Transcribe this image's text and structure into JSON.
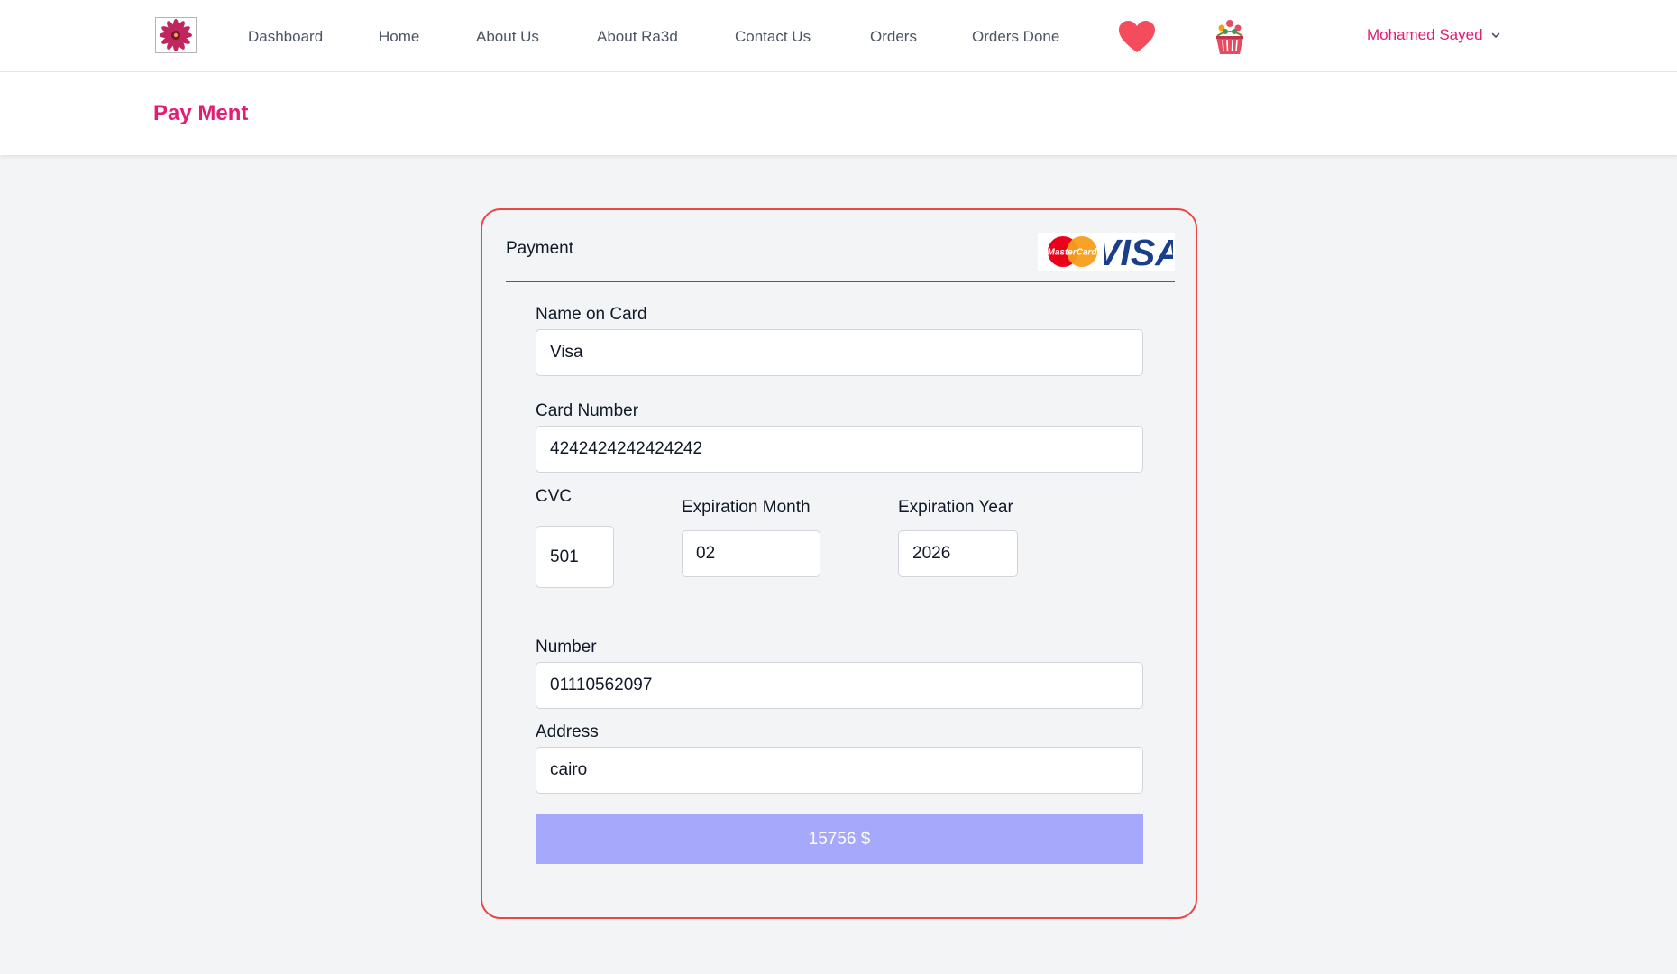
{
  "navbar": {
    "logo_icon": "flower-logo-icon",
    "links": [
      {
        "label": "Dashboard"
      },
      {
        "label": "Home"
      },
      {
        "label": "About Us"
      },
      {
        "label": "About Ra3d"
      },
      {
        "label": "Contact Us"
      },
      {
        "label": "Orders"
      },
      {
        "label": "Orders Done"
      }
    ],
    "wishlist_icon": "heart-icon",
    "cart_icon": "flower-basket-icon",
    "user_name": "Mohamed Sayed",
    "user_menu_icon": "chevron-down-icon"
  },
  "page": {
    "title": "Pay Ment"
  },
  "payment": {
    "title": "Payment",
    "mastercard_text": "MasterCard",
    "visa_text": "VISA",
    "fields": {
      "name_on_card": {
        "label": "Name on Card",
        "value": "Visa"
      },
      "card_number": {
        "label": "Card Number",
        "value": "4242424242424242"
      },
      "cvc": {
        "label": "CVC",
        "value": "501"
      },
      "expiration_month": {
        "label": "Expiration Month",
        "value": "02"
      },
      "expiration_year": {
        "label": "Expiration Year",
        "value": "2026"
      },
      "phone_number": {
        "label": "Number",
        "value": "01110562097"
      },
      "address": {
        "label": "Address",
        "value": "cairo"
      }
    },
    "pay_button_label": "15756 $"
  },
  "colors": {
    "brand_pink": "#e11d74",
    "card_border": "#ef4444",
    "pay_button": "#a5a8fb",
    "page_background": "#f3f4f6"
  }
}
